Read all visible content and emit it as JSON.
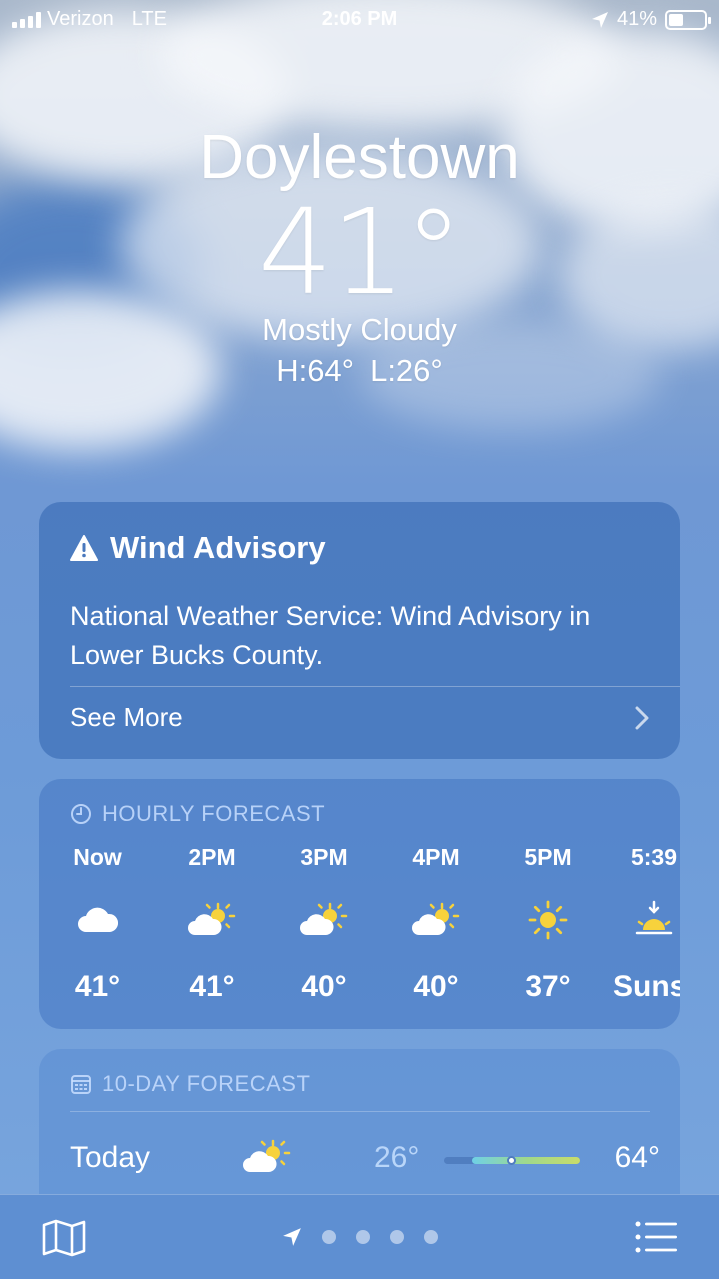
{
  "status_bar": {
    "carrier": "Verizon",
    "network": "LTE",
    "time": "2:06 PM",
    "battery": "41%",
    "battery_level": 0.41,
    "signal_bars": 4
  },
  "hero": {
    "city": "Doylestown",
    "temperature": "41°",
    "condition": "Mostly Cloudy",
    "high": "H:64°",
    "low": "L:26°"
  },
  "advisory": {
    "icon": "warning-triangle-icon",
    "title": "Wind Advisory",
    "body": "National Weather Service: Wind Advisory in Lower Bucks County.",
    "see_more": "See More"
  },
  "hourly": {
    "header": "HOURLY FORECAST",
    "hours": [
      {
        "label": "Now",
        "icon": "cloud-icon",
        "temp": "41°"
      },
      {
        "label": "2PM",
        "icon": "partly-sunny-icon",
        "temp": "41°"
      },
      {
        "label": "3PM",
        "icon": "partly-sunny-icon",
        "temp": "40°"
      },
      {
        "label": "4PM",
        "icon": "partly-sunny-icon",
        "temp": "40°"
      },
      {
        "label": "5PM",
        "icon": "sun-icon",
        "temp": "37°"
      },
      {
        "label": "5:39",
        "icon": "sunset-icon",
        "temp": "Sunset"
      }
    ]
  },
  "ten_day": {
    "header": "10-DAY FORECAST",
    "rows": [
      {
        "day": "Today",
        "icon": "partly-sunny-icon",
        "low": "26°",
        "high": "64°",
        "current_position": 0.5
      }
    ]
  },
  "bottom_bar": {
    "page_count": 4
  },
  "colors": {
    "card": "#3f70b9",
    "bottom_bar": "#5e8fd2",
    "range_gradient": [
      "#6fd0e6",
      "#9fd88c",
      "#c9dc6a"
    ],
    "sun": "#f7d23c"
  }
}
